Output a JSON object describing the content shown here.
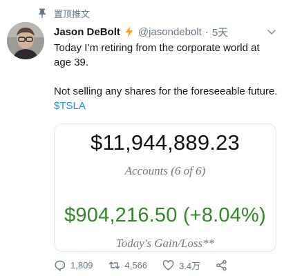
{
  "pinned": {
    "label": "置顶推文"
  },
  "tweet": {
    "display_name": "Jason DeBolt",
    "handle": "@jasondebolt",
    "separator": "·",
    "time": "5天",
    "text_line1": "Today I’m retiring from the corporate world at age 39.",
    "text_line2": "Not selling any shares for the foreseeable future. ",
    "cashtag": "$TSLA"
  },
  "card": {
    "balance": "$11,944,889.23",
    "accounts": "Accounts (6 of 6)",
    "gain": "$904,216.50 (+8.04%)",
    "gain_label": "Today's Gain/Loss**"
  },
  "actions": {
    "replies": "1,809",
    "retweets": "4,566",
    "likes": "3.4万"
  },
  "colors": {
    "accent": "#1b95e0",
    "gain_green": "#2e8b22",
    "secondary_text": "#657786",
    "bolt": "#f5a623"
  },
  "icons": [
    "pin-icon",
    "lightning-bolt-icon",
    "chevron-down-icon",
    "reply-icon",
    "retweet-icon",
    "like-icon",
    "share-icon"
  ]
}
